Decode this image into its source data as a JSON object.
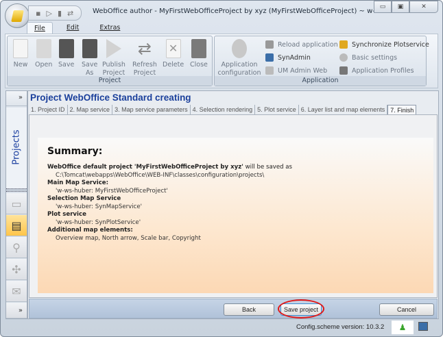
{
  "window": {
    "title": "WebOffice author - MyFirstWebOfficeProject by xyz (MyFirstWebOfficeProject) ~ w-ws-huber -...",
    "minimize": "▭",
    "maximize": "▣",
    "close": "✕"
  },
  "qat": [
    "save-icon",
    "publish-icon",
    "close-icon",
    "refresh-icon"
  ],
  "menu": {
    "file": "File",
    "edit": "Edit",
    "extras": "Extras"
  },
  "ribbon": {
    "project": {
      "label": "Project",
      "buttons": [
        "New",
        "Open",
        "Save",
        "Save\nAs",
        "Publish\nProject",
        "Refresh\nProject",
        "Delete",
        "Close"
      ]
    },
    "application": {
      "label": "Application",
      "config": "Application\nconfiguration",
      "reload": "Reload application",
      "synadmin": "SynAdmin",
      "umadmin": "UM Admin Web",
      "sync": "Synchronize Plotservice",
      "basic": "Basic settings",
      "profiles": "Application Profiles"
    }
  },
  "sidebar": {
    "expand": "»",
    "title": "Projects",
    "more": "»"
  },
  "main": {
    "title": "Project WebOffice Standard creating",
    "tabs": [
      "1. Project ID",
      "2. Map service",
      "3. Map service parameters",
      "4. Selection rendering",
      "5. Plot service",
      "6. Layer list and map elements",
      "7. Finish"
    ],
    "summary": {
      "heading": "Summary:",
      "intro_bold": "WebOffice default project 'MyFirstWebOfficeProject by xyz'",
      "intro_rest": " will be saved as",
      "path": "C:\\Tomcat\\webapps\\WebOffice\\WEB-INF\\classes\\configuration\\projects\\",
      "main_label": "Main Map Service:",
      "main_value": "'w-ws-huber: MyFirstWebOfficeProject'",
      "sel_label": "Selection Map Service",
      "sel_value": "'w-ws-huber: SynMapService'",
      "plot_label": "Plot service",
      "plot_value": "'w-ws-huber: SynPlotService'",
      "add_label": "Additional map elements:",
      "add_value": "Overview map, North arrow, Scale bar, Copyright"
    },
    "buttons": {
      "back": "Back",
      "save": "Save project",
      "cancel": "Cancel"
    }
  },
  "status": {
    "version": "Config.scheme version:  10.3.2",
    "user_icon": "♟"
  },
  "colors": {
    "accent": "#1a3f9b",
    "highlight": "#e01818"
  }
}
